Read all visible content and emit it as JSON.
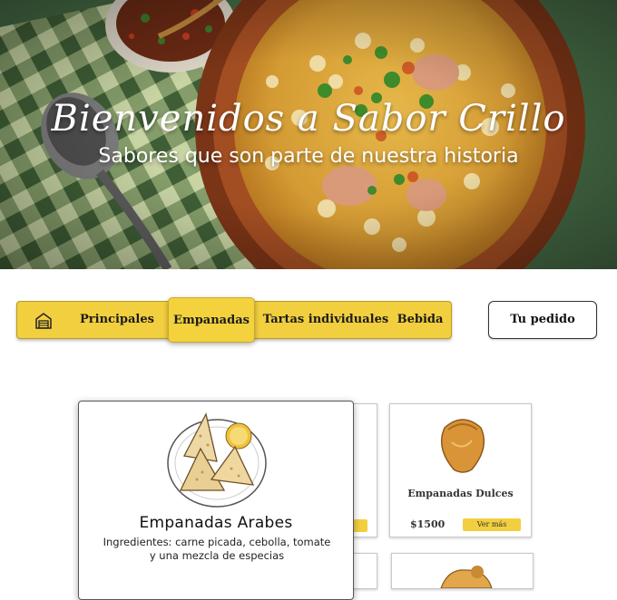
{
  "hero": {
    "title": "Bienvenidos a Sabor Crillo",
    "subtitle": "Sabores que son parte de nuestra historia"
  },
  "nav": {
    "icon": "store-icon",
    "items": [
      {
        "label": "Principales",
        "active": false
      },
      {
        "label": "Empanadas",
        "active": true
      },
      {
        "label": "Tartas individuales",
        "active": false
      },
      {
        "label": "Bebida",
        "active": false
      }
    ],
    "order_label": "Tu pedido"
  },
  "products": [
    {
      "name": "Empanadas Dulces",
      "price": "$1500",
      "button": "Ver más"
    }
  ],
  "popup": {
    "title": "Empanadas Arabes",
    "description": "Ingredientes: carne picada, cebolla, tomate y una mezcla de especias"
  },
  "colors": {
    "accent": "#f2cf3f",
    "hero_green": "#3d5a3b",
    "stew_bowl": "#8c3f1d"
  }
}
